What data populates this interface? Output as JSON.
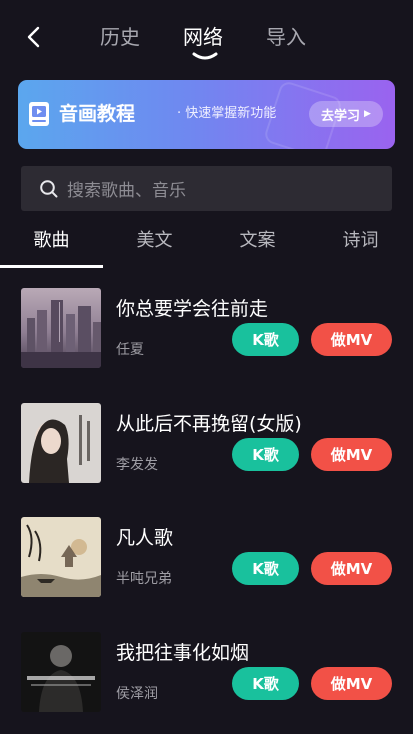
{
  "header": {
    "tabs": [
      {
        "label": "历史"
      },
      {
        "label": "网络"
      },
      {
        "label": "导入"
      }
    ],
    "active_tab": "网络"
  },
  "banner": {
    "title": "音画教程",
    "subtitle": "· 快速掌握新功能",
    "button_label": "去学习"
  },
  "search": {
    "placeholder": "搜索歌曲、音乐"
  },
  "categories": [
    {
      "label": "歌曲"
    },
    {
      "label": "美文"
    },
    {
      "label": "文案"
    },
    {
      "label": "诗词"
    }
  ],
  "active_category": "歌曲",
  "songs": [
    {
      "title": "你总要学会往前走",
      "artist": "任夏",
      "k_label": "K歌",
      "mv_label": "做MV"
    },
    {
      "title": "从此后不再挽留(女版)",
      "artist": "李发发",
      "k_label": "K歌",
      "mv_label": "做MV"
    },
    {
      "title": "凡人歌",
      "artist": "半吨兄弟",
      "k_label": "K歌",
      "mv_label": "做MV"
    },
    {
      "title": "我把往事化如烟",
      "artist": "侯泽润",
      "k_label": "K歌",
      "mv_label": "做MV"
    }
  ],
  "colors": {
    "background": "#16141d",
    "karaoke_button": "#19c19d",
    "mv_button": "#f25147",
    "banner_gradient_start": "#5ba7ee",
    "banner_gradient_end": "#9a63ef"
  }
}
